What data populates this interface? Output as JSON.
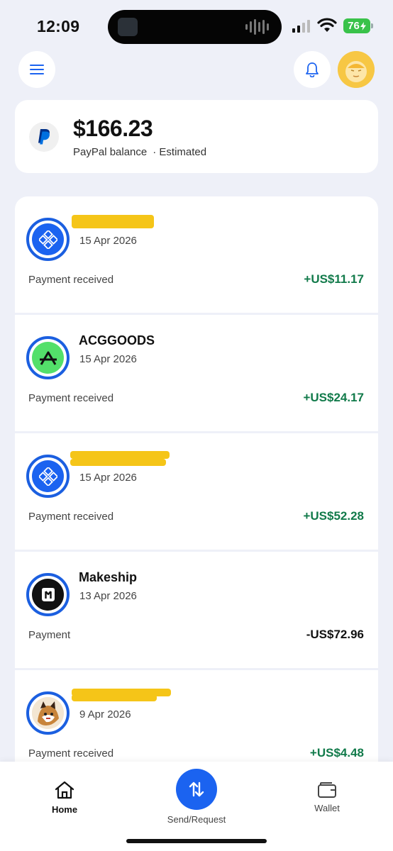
{
  "status_bar": {
    "time": "12:09",
    "battery": "76"
  },
  "header": {
    "menu_icon": "hamburger-icon",
    "bell_icon": "bell-icon",
    "avatar": "profile-avatar"
  },
  "balance": {
    "amount": "$166.23",
    "label": "PayPal balance",
    "estimated": "· Estimated"
  },
  "transactions": [
    {
      "name": "",
      "date": "15 Apr 2026",
      "type": "Payment received",
      "amount": "+US$11.17",
      "direction": "in",
      "icon": "diamond-grid-icon"
    },
    {
      "name": "ACGGOODS",
      "date": "15 Apr 2026",
      "type": "Payment received",
      "amount": "+US$24.17",
      "direction": "in",
      "icon": "acggoods-logo-icon"
    },
    {
      "name": "",
      "date": "15 Apr 2026",
      "type": "Payment received",
      "amount": "+US$52.28",
      "direction": "in",
      "icon": "diamond-grid-icon"
    },
    {
      "name": "Makeship",
      "date": "13 Apr 2026",
      "type": "Payment",
      "amount": "-US$72.96",
      "direction": "out",
      "icon": "makeship-logo-icon"
    },
    {
      "name": "",
      "date": "9 Apr 2026",
      "type": "Payment received",
      "amount": "+US$4.48",
      "direction": "in",
      "icon": "user-avatar-icon"
    }
  ],
  "nav": {
    "home": "Home",
    "send_request": "Send/Request",
    "wallet": "Wallet"
  },
  "colors": {
    "accent": "#1b63f0",
    "positive": "#117a4a",
    "background": "#eef0f8",
    "redaction": "#f5c518"
  }
}
